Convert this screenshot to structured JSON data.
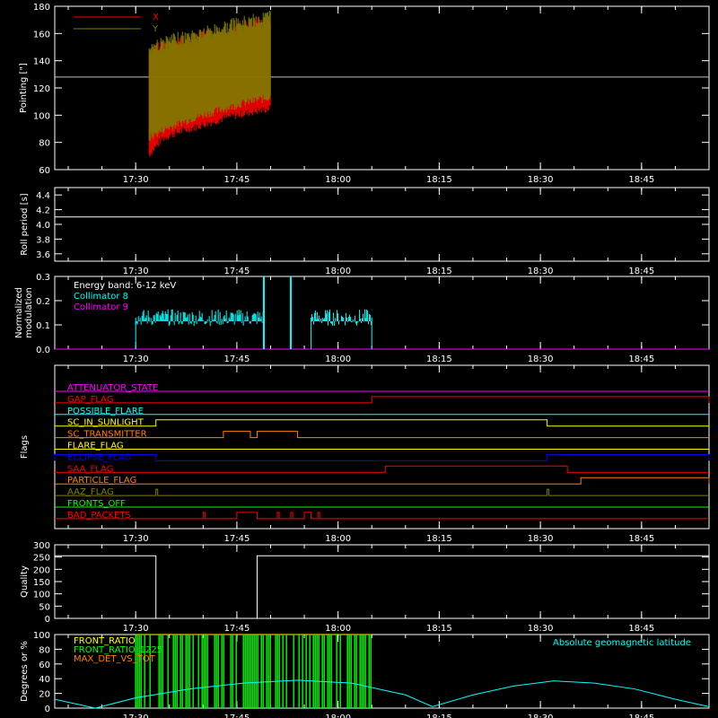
{
  "chart_data": [
    {
      "type": "line",
      "ylabel": "Pointing [\"]",
      "ylim": [
        60,
        180
      ],
      "yticks": [
        "60",
        "80",
        "100",
        "120",
        "140",
        "160",
        "180"
      ],
      "xticks": [
        "17:30",
        "17:45",
        "18:00",
        "18:15",
        "18:30",
        "18:45"
      ],
      "reference_line": 128,
      "series": [
        {
          "name": "X",
          "color": "#ff0000",
          "x": [
            "17:32",
            "17:34",
            "17:36",
            "17:38",
            "17:40",
            "17:42",
            "17:44",
            "17:46",
            "17:48",
            "17:50"
          ],
          "y_low": [
            68,
            80,
            84,
            87,
            90,
            93,
            96,
            98,
            100,
            102
          ],
          "y_high": [
            150,
            156,
            158,
            160,
            163,
            165,
            168,
            170,
            172,
            175
          ]
        },
        {
          "name": "Y",
          "color": "#808000",
          "x": [
            "17:32",
            "17:34",
            "17:36",
            "17:38",
            "17:40",
            "17:42",
            "17:44",
            "17:46",
            "17:48",
            "17:50"
          ],
          "y_low": [
            80,
            86,
            90,
            94,
            97,
            100,
            103,
            106,
            108,
            110
          ],
          "y_high": [
            155,
            158,
            161,
            163,
            166,
            168,
            171,
            173,
            175,
            178
          ]
        }
      ]
    },
    {
      "type": "line",
      "ylabel": "Roll period [s]",
      "ylim": [
        3.5,
        4.5
      ],
      "yticks": [
        "3.6",
        "3.8",
        "4.0",
        "4.2",
        "4.4"
      ],
      "xticks": [
        "17:30",
        "17:45",
        "18:00",
        "18:15",
        "18:30",
        "18:45"
      ],
      "series": [
        {
          "color": "#ffffff",
          "x": [
            "17:18",
            "18:55"
          ],
          "y": [
            4.1,
            4.1
          ]
        }
      ]
    },
    {
      "type": "line",
      "ylabel": "Normalized modulation",
      "ylim": [
        0,
        0.3
      ],
      "yticks": [
        "0.0",
        "0.1",
        "0.2",
        "0.3"
      ],
      "xticks": [
        "17:30",
        "17:45",
        "18:00",
        "18:15",
        "18:30",
        "18:45"
      ],
      "annotation": "Energy band: 6-12 keV",
      "series": [
        {
          "name": "Collimator 8",
          "color": "#00ffff",
          "segments": [
            [
              "17:30",
              "17:49"
            ],
            [
              "17:56",
              "18:05"
            ]
          ],
          "level": 0.13,
          "spikes": [
            {
              "x": "17:49",
              "y": 0.3
            },
            {
              "x": "17:53",
              "y": 0.3
            }
          ]
        },
        {
          "name": "Collimator 9",
          "color": "#ff00ff",
          "level": 0.0
        }
      ]
    },
    {
      "type": "flags",
      "ylabel": "Flags",
      "xticks": [
        "17:30",
        "17:45",
        "18:00",
        "18:15",
        "18:30",
        "18:45"
      ],
      "rows": [
        {
          "name": "ATTENUATOR_STATE",
          "color": "#ff00ff",
          "highs": []
        },
        {
          "name": "GAP_FLAG",
          "color": "#ff0000",
          "highs": [
            [
              "18:05",
              "18:55"
            ]
          ]
        },
        {
          "name": "POSSIBLE_FLARE",
          "color": "#00ffff",
          "highs": []
        },
        {
          "name": "SC_IN_SUNLIGHT",
          "color": "#ffff00",
          "highs": [
            [
              "17:33",
              "18:31"
            ]
          ]
        },
        {
          "name": "SC_TRANSMITTER",
          "color": "#ff8000",
          "highs": [
            [
              "17:43",
              "17:47"
            ],
            [
              "17:48",
              "17:54"
            ]
          ]
        },
        {
          "name": "FLARE_FLAG",
          "color": "#ffff00",
          "highs": []
        },
        {
          "name": "ECLIPSE_FLAG",
          "color": "#0000ff",
          "highs": [
            [
              "17:18",
              "17:33"
            ],
            [
              "18:31",
              "18:55"
            ]
          ]
        },
        {
          "name": "SAA_FLAG",
          "color": "#ff0000",
          "highs": [
            [
              "18:07",
              "18:34"
            ]
          ]
        },
        {
          "name": "PARTICLE_FLAG",
          "color": "#ff8000",
          "highs": [
            [
              "18:36",
              "18:55"
            ]
          ]
        },
        {
          "name": "AAZ_FLAG",
          "color": "#808000",
          "highs": [
            [
              "17:33",
              "17:33"
            ],
            [
              "18:31",
              "18:31"
            ]
          ]
        },
        {
          "name": "FRONTS_OFF",
          "color": "#00ff00",
          "highs": []
        },
        {
          "name": "BAD_PACKETS",
          "color": "#ff0000",
          "highs": [
            [
              "17:40",
              "17:40"
            ],
            [
              "17:45",
              "17:48"
            ],
            [
              "17:51",
              "17:51"
            ],
            [
              "17:53",
              "17:53"
            ],
            [
              "17:55",
              "17:56"
            ],
            [
              "17:57",
              "17:57"
            ]
          ]
        }
      ]
    },
    {
      "type": "line",
      "ylabel": "Quality",
      "ylim": [
        0,
        300
      ],
      "yticks": [
        "0",
        "50",
        "100",
        "150",
        "200",
        "250",
        "300"
      ],
      "xticks": [
        "17:30",
        "17:45",
        "18:00",
        "18:15",
        "18:30",
        "18:45"
      ],
      "series": [
        {
          "color": "#ffffff",
          "x": [
            "17:18",
            "17:33",
            "17:33",
            "17:48",
            "17:48",
            "18:55"
          ],
          "y": [
            255,
            255,
            0,
            0,
            255,
            255
          ]
        }
      ]
    },
    {
      "type": "line",
      "ylabel": "Degrees or %",
      "ylim": [
        0,
        100
      ],
      "yticks": [
        "0",
        "20",
        "40",
        "60",
        "80",
        "100"
      ],
      "xticks": [
        "17:30",
        "17:45",
        "18:00",
        "18:15",
        "18:30",
        "18:45"
      ],
      "annotation": "Absolute geomagnetic latitude",
      "series": [
        {
          "name": "FRONT_RATIO",
          "color": "#ffff00",
          "range": [
            "17:30",
            "18:05"
          ]
        },
        {
          "name": "FRONT_RATIO_1225",
          "color": "#00ff00",
          "range": [
            "17:30",
            "18:05"
          ]
        },
        {
          "name": "MAX_DET_VS_TOT",
          "color": "#ff8000"
        },
        {
          "name": "Absolute geomagnetic latitude",
          "color": "#00ffff",
          "x": [
            "17:18",
            "17:24",
            "17:30",
            "17:38",
            "17:46",
            "17:54",
            "18:02",
            "18:10",
            "18:14",
            "18:20",
            "18:26",
            "18:32",
            "18:38",
            "18:44",
            "18:50",
            "18:55"
          ],
          "y": [
            12,
            0,
            14,
            26,
            34,
            38,
            34,
            18,
            2,
            18,
            30,
            37,
            34,
            26,
            12,
            2
          ]
        }
      ]
    }
  ]
}
